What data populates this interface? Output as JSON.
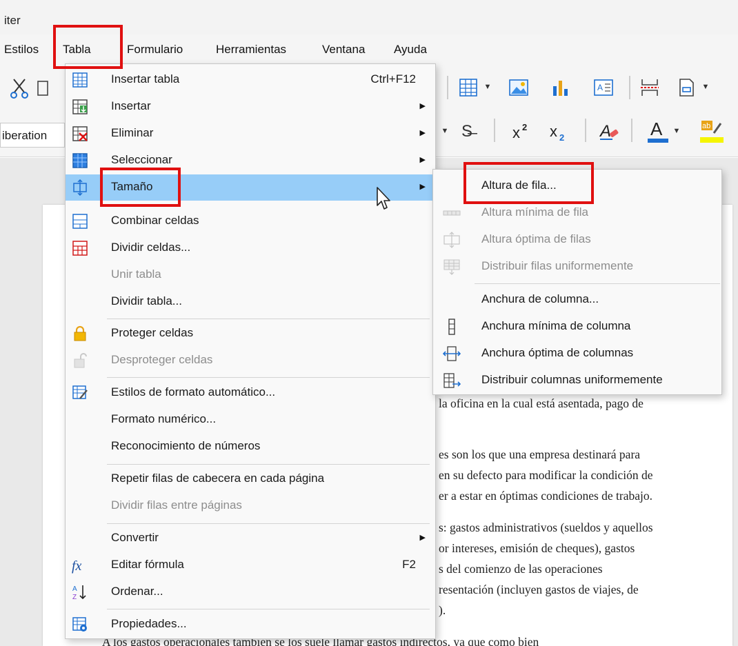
{
  "window": {
    "title_fragment": "iter"
  },
  "menubar": {
    "items": [
      "Estilos",
      "Tabla",
      "Formulario",
      "Herramientas",
      "Ventana",
      "Ayuda"
    ]
  },
  "toolbar": {
    "font_name": "iberation"
  },
  "tabla_menu": {
    "items": [
      {
        "label": "Insertar tabla",
        "shortcut": "Ctrl+F12",
        "icon": "insert-table-icon",
        "enabled": true,
        "submenu": false
      },
      {
        "label": "Insertar",
        "icon": "insert-rows-icon",
        "enabled": true,
        "submenu": true
      },
      {
        "label": "Eliminar",
        "icon": "delete-table-icon",
        "enabled": true,
        "submenu": true
      },
      {
        "label": "Seleccionar",
        "icon": "select-table-icon",
        "enabled": true,
        "submenu": true
      },
      {
        "label": "Tamaño",
        "icon": "resize-icon",
        "enabled": true,
        "submenu": true,
        "active": true
      },
      {
        "label": "Combinar celdas",
        "icon": "merge-cells-icon",
        "enabled": true
      },
      {
        "label": "Dividir celdas...",
        "icon": "split-cells-icon",
        "enabled": true
      },
      {
        "label": "Unir tabla",
        "enabled": false
      },
      {
        "label": "Dividir tabla...",
        "enabled": true
      },
      {
        "label": "Proteger celdas",
        "icon": "lock-icon",
        "enabled": true
      },
      {
        "label": "Desproteger celdas",
        "icon": "unlock-icon",
        "enabled": false
      },
      {
        "label": "Estilos de formato automático...",
        "icon": "autoformat-icon",
        "enabled": true
      },
      {
        "label": "Formato numérico...",
        "enabled": true
      },
      {
        "label": "Reconocimiento de números",
        "enabled": true
      },
      {
        "label": "Repetir filas de cabecera en cada página",
        "enabled": true
      },
      {
        "label": "Dividir filas entre páginas",
        "enabled": false
      },
      {
        "label": "Convertir",
        "enabled": true,
        "submenu": true
      },
      {
        "label": "Editar fórmula",
        "shortcut": "F2",
        "icon": "formula-icon",
        "enabled": true
      },
      {
        "label": "Ordenar...",
        "icon": "sort-icon",
        "enabled": true
      },
      {
        "label": "Propiedades...",
        "icon": "table-properties-icon",
        "enabled": true
      }
    ]
  },
  "tamano_submenu": {
    "items": [
      {
        "label": "Altura de fila...",
        "enabled": true
      },
      {
        "label": "Altura mínima de fila",
        "icon": "min-row-height-icon",
        "enabled": false
      },
      {
        "label": "Altura óptima de filas",
        "icon": "optimal-row-height-icon",
        "enabled": false
      },
      {
        "label": "Distribuir filas uniformemente",
        "icon": "distribute-rows-icon",
        "enabled": false
      },
      {
        "label": "Anchura de columna...",
        "enabled": true
      },
      {
        "label": "Anchura mínima de columna",
        "icon": "min-column-width-icon",
        "enabled": true
      },
      {
        "label": "Anchura óptima de columnas",
        "icon": "optimal-column-width-icon",
        "enabled": true
      },
      {
        "label": "Distribuir columnas uniformemente",
        "icon": "distribute-columns-icon",
        "enabled": true
      }
    ]
  },
  "document": {
    "lines": [
      "la oficina en la cual está asentada, pago de",
      "es son los que una empresa destinará para",
      "en su defecto para modificar la condición de",
      "er a estar en óptimas condiciones de trabajo.",
      "s: gastos administrativos (sueldos y aquellos",
      "or intereses, emisión de cheques), gastos",
      "s del comienzo de las operaciones",
      "resentación (incluyen gastos de viajes, de",
      ").",
      "A los gastos operacionales también se los suele llamar gastos indirectos, ya que como bien"
    ]
  },
  "colors": {
    "highlight_box": "#e01010",
    "active_item_bg": "#97cdf8",
    "disabled_text": "#8d8d8d"
  }
}
